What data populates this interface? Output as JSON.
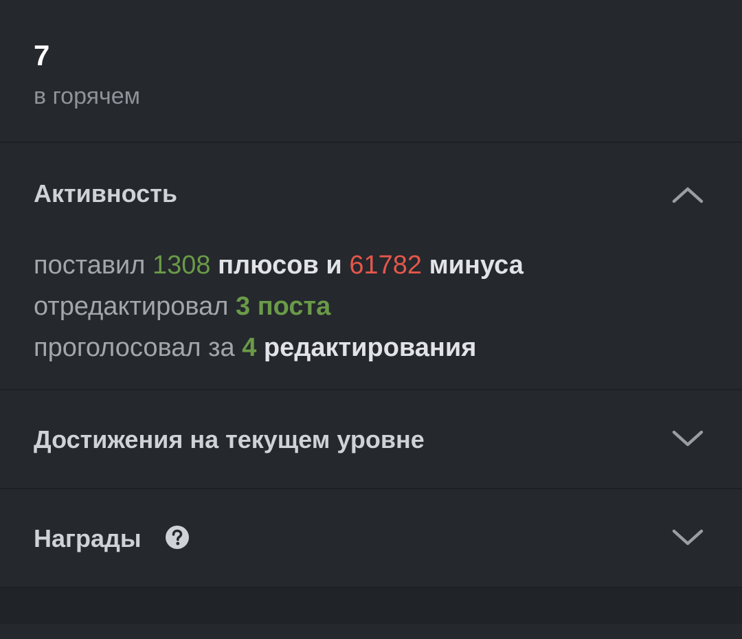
{
  "stat": {
    "value": "7",
    "label": "в горячем"
  },
  "sections": {
    "activity": {
      "title": "Активность",
      "expanded": true,
      "chevron_icon": "chevron-up-icon",
      "lines": {
        "line1": {
          "prefix": "поставил",
          "pluses": "1308",
          "pluses_word": "плюсов и",
          "minuses": "61782",
          "minuses_word": "минуса"
        },
        "line2": {
          "prefix": "отредактировал",
          "count": "3 поста"
        },
        "line3": {
          "prefix": "проголосовал за",
          "count": "4",
          "suffix": "редактирования"
        }
      }
    },
    "achievements": {
      "title": "Достижения на текущем уровне",
      "expanded": false,
      "chevron_icon": "chevron-down-icon"
    },
    "rewards": {
      "title": "Награды",
      "help_icon": "question-circle-icon",
      "expanded": false,
      "chevron_icon": "chevron-down-icon"
    }
  },
  "colors": {
    "background": "#25282d",
    "positive": "#6a9a48",
    "negative": "#e5574a",
    "muted_text": "#8f949a"
  }
}
